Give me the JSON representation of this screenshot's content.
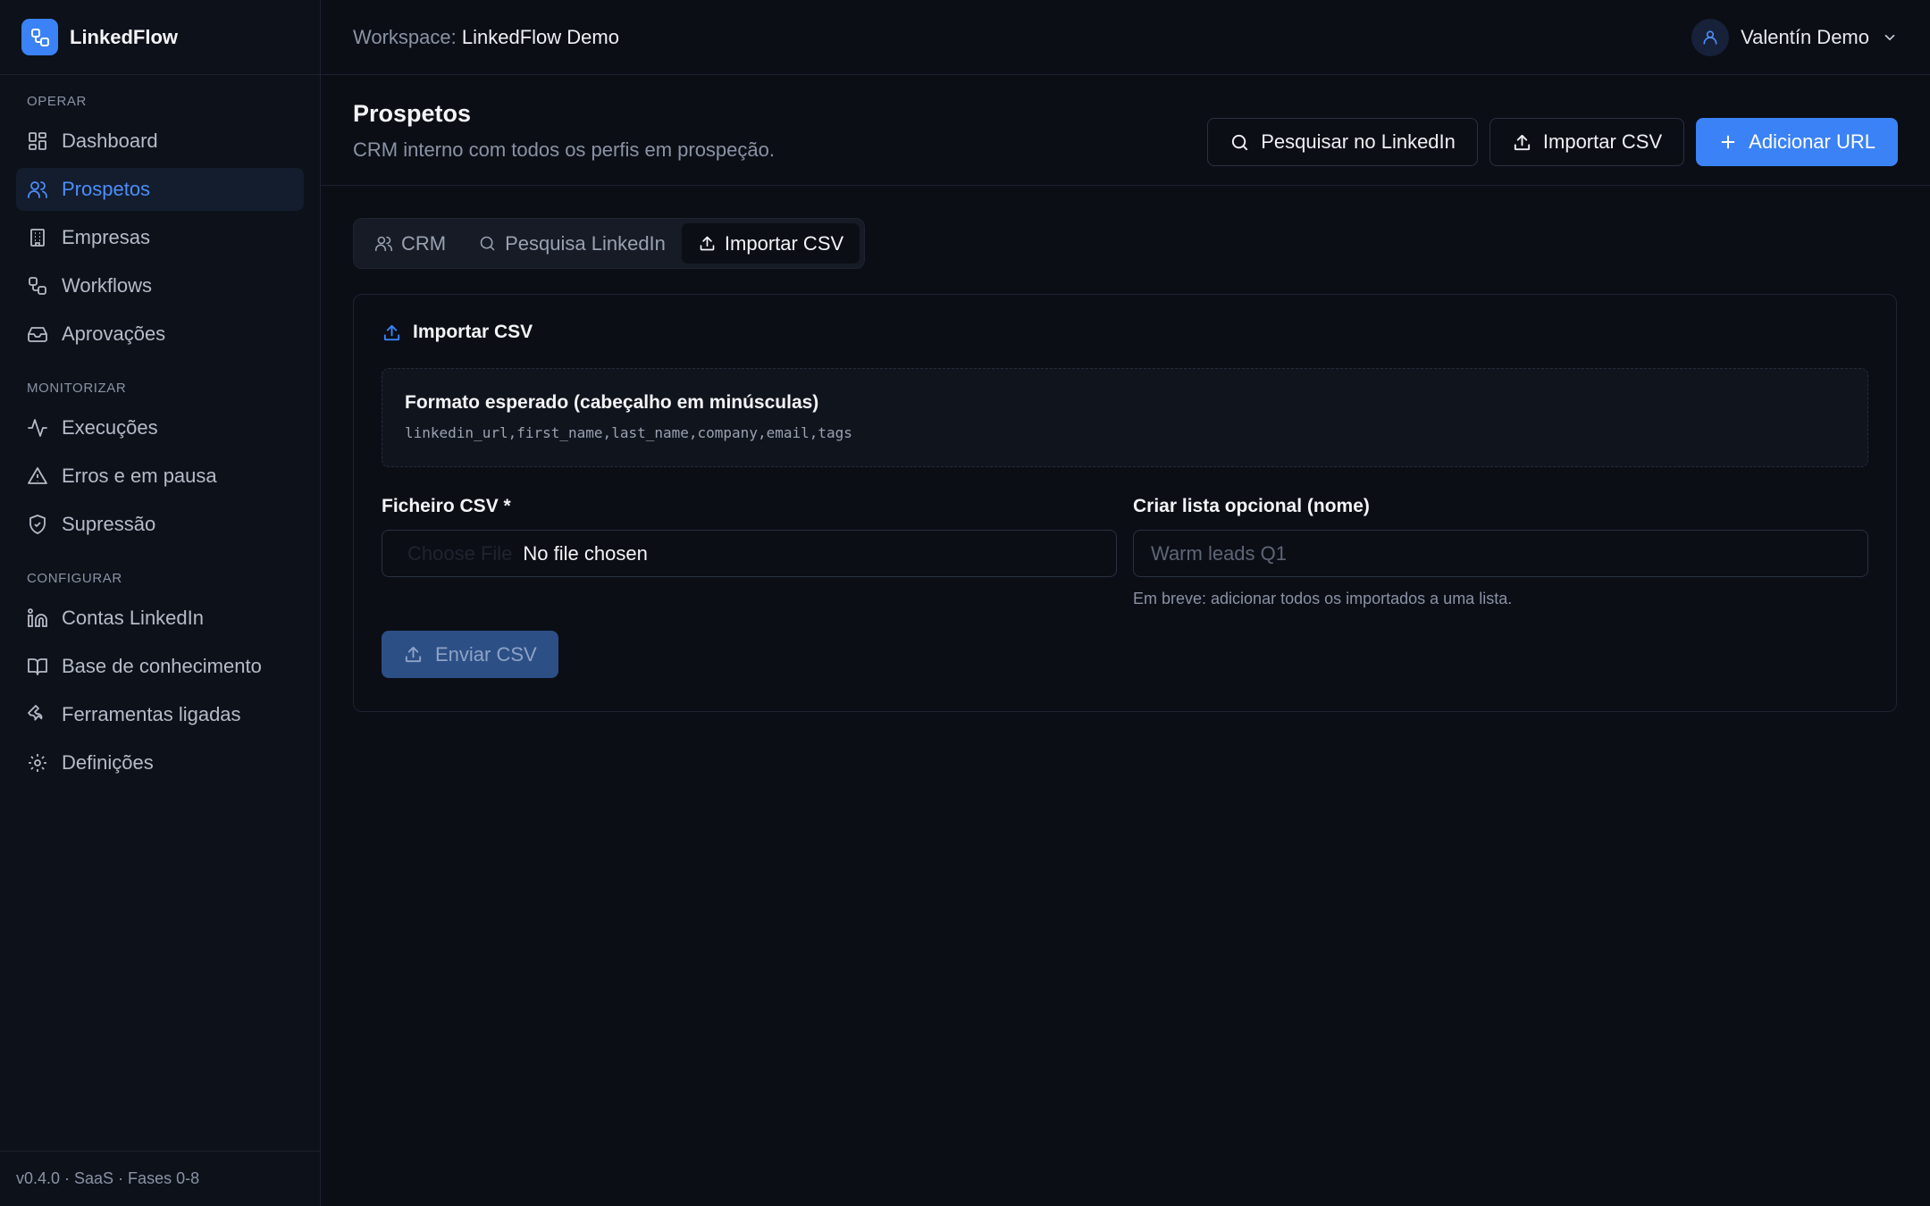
{
  "brand": {
    "name": "LinkedFlow"
  },
  "sidebar": {
    "sections": [
      {
        "label": "OPERAR",
        "items": [
          "Dashboard",
          "Prospetos",
          "Empresas",
          "Workflows",
          "Aprovações"
        ]
      },
      {
        "label": "MONITORIZAR",
        "items": [
          "Execuções",
          "Erros e em pausa",
          "Supressão"
        ]
      },
      {
        "label": "CONFIGURAR",
        "items": [
          "Contas LinkedIn",
          "Base de conhecimento",
          "Ferramentas ligadas",
          "Definições"
        ]
      }
    ],
    "active_item": "Prospetos",
    "footer": "v0.4.0 · SaaS · Fases 0-8"
  },
  "topbar": {
    "workspace_label": "Workspace:",
    "workspace_name": "LinkedFlow Demo",
    "user_name": "Valentín Demo"
  },
  "page": {
    "title": "Prospetos",
    "subtitle": "CRM interno com todos os perfis em prospeção.",
    "actions": {
      "search_linkedin": "Pesquisar no LinkedIn",
      "import_csv": "Importar CSV",
      "add_url": "Adicionar URL"
    }
  },
  "tabs": [
    {
      "label": "CRM",
      "icon": "users-icon"
    },
    {
      "label": "Pesquisa LinkedIn",
      "icon": "search-icon"
    },
    {
      "label": "Importar CSV",
      "icon": "upload-icon",
      "active": true
    }
  ],
  "import_card": {
    "title": "Importar CSV",
    "format_title": "Formato esperado (cabeçalho em minúsculas)",
    "format_code": "linkedin_url,first_name,last_name,company,email,tags",
    "file_label": "Ficheiro CSV *",
    "file_button": "Choose File",
    "file_status": "No file chosen",
    "list_label": "Criar lista opcional (nome)",
    "list_placeholder": "Warm leads Q1",
    "list_value": "",
    "list_hint": "Em breve: adicionar todos os importados a uma lista.",
    "submit_label": "Enviar CSV"
  },
  "colors": {
    "accent": "#3b82f6",
    "background": "#0b0e15",
    "sidebar": "#0d1119"
  }
}
